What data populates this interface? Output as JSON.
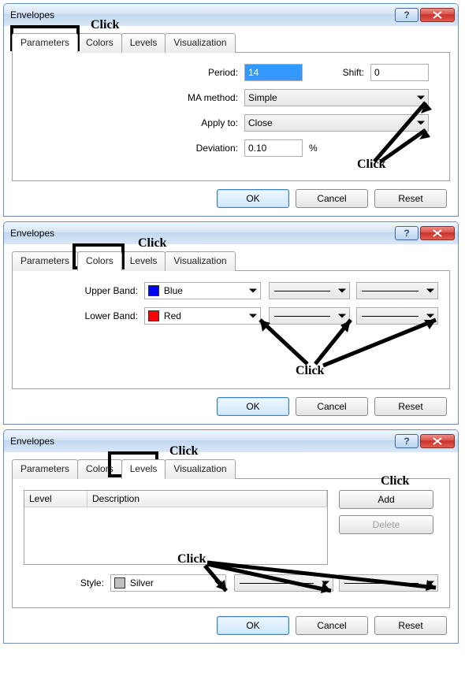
{
  "windows": {
    "w1": {
      "title": "Envelopes",
      "tabs": [
        "Parameters",
        "Colors",
        "Levels",
        "Visualization"
      ],
      "active_tab": 0,
      "fields": {
        "period_label": "Period:",
        "period_value": "14",
        "shift_label": "Shift:",
        "shift_value": "0",
        "ma_label": "MA method:",
        "ma_value": "Simple",
        "apply_label": "Apply to:",
        "apply_value": "Close",
        "dev_label": "Deviation:",
        "dev_value": "0.10",
        "dev_unit": "%"
      },
      "buttons": {
        "ok": "OK",
        "cancel": "Cancel",
        "reset": "Reset"
      },
      "annot": {
        "top": "Click",
        "right": "Click"
      }
    },
    "w2": {
      "title": "Envelopes",
      "tabs": [
        "Parameters",
        "Colors",
        "Levels",
        "Visualization"
      ],
      "active_tab": 1,
      "fields": {
        "upper_label": "Upper Band:",
        "upper_color_name": "Blue",
        "upper_color_hex": "#0000ff",
        "lower_label": "Lower Band:",
        "lower_color_name": "Red",
        "lower_color_hex": "#ff0000"
      },
      "buttons": {
        "ok": "OK",
        "cancel": "Cancel",
        "reset": "Reset"
      },
      "annot": {
        "top": "Click",
        "bottom": "Click"
      }
    },
    "w3": {
      "title": "Envelopes",
      "tabs": [
        "Parameters",
        "Colors",
        "Levels",
        "Visualization"
      ],
      "active_tab": 2,
      "table": {
        "col1": "Level",
        "col2": "Description"
      },
      "style_label": "Style:",
      "style_color_name": "Silver",
      "style_color_hex": "#c0c0c0",
      "side_buttons": {
        "add": "Add",
        "delete": "Delete"
      },
      "buttons": {
        "ok": "OK",
        "cancel": "Cancel",
        "reset": "Reset"
      },
      "annot": {
        "top": "Click",
        "add": "Click",
        "style": "Click"
      }
    }
  }
}
